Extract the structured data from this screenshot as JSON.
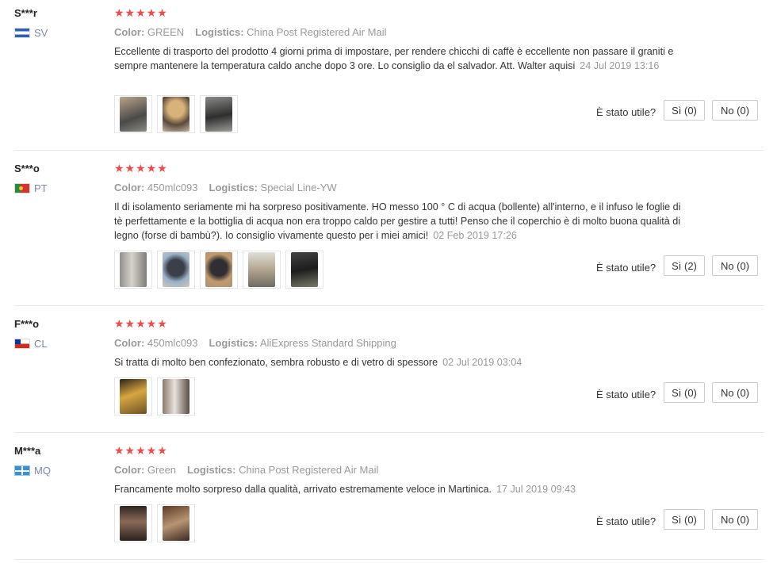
{
  "labels": {
    "color": "Color:",
    "logistics": "Logistics:",
    "helpful": "È stato utile?"
  },
  "stars": "★★★★★",
  "reviews": [
    {
      "user": "S***r",
      "country": "SV",
      "color": "GREEN",
      "logistics": "China Post Registered Air Mail",
      "text": "Eccellente di trasporto del prodotto 4 giorni prima di impostare, per rendere chicchi di caffè è eccellente non passare il graniti e sempre mantenere la temperatura caldo anche dopo 3 ore. Lo consiglio da el salvador. Att. Walter aquisi",
      "date": "24 Jul 2019 13:16",
      "yes": "Sì (0)",
      "no": "No (0)"
    },
    {
      "user": "S***o",
      "country": "PT",
      "color": "450mlc093",
      "logistics": "Special Line-YW",
      "text": "Il di isolamento seriamente mi ha sorpreso positivamente. HO messo 100 ° C di acqua (bollente) all'interno, e il infuso le foglie di tè perfettamente e la bottiglia di acqua non era troppo caldo per gestire a tutti! Penso che il coperchio è di molto buona qualità di legno (forse di bambù?). Io consiglio vivamente questo per i miei amici!",
      "date": "02 Feb 2019 17:26",
      "yes": "Sì (2)",
      "no": "No (0)"
    },
    {
      "user": "F***o",
      "country": "CL",
      "color": "450mlc093",
      "logistics": "AliExpress Standard Shipping",
      "text": "Si tratta di molto ben confezionato, sembra robusto e di vetro di spessore",
      "date": "02 Jul 2019 03:04",
      "yes": "Sì (0)",
      "no": "No (0)"
    },
    {
      "user": "M***a",
      "country": "MQ",
      "color": "Green",
      "logistics": "China Post Registered Air Mail",
      "text": "Francamente molto sorpreso dalla qualità, arrivato estremamente veloce in Martinica.",
      "date": "17 Jul 2019 09:43",
      "yes": "Sì (0)",
      "no": "No (0)"
    }
  ]
}
